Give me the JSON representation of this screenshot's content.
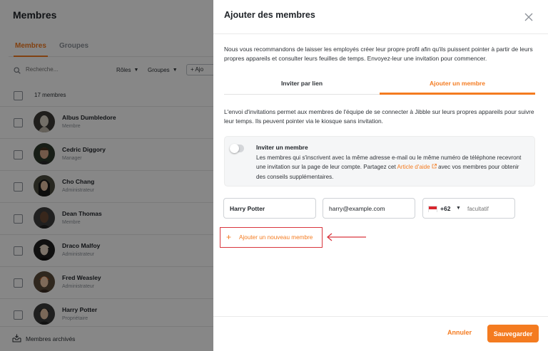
{
  "page": {
    "title": "Membres",
    "tabs": [
      {
        "label": "Membres",
        "active": true
      },
      {
        "label": "Groupes",
        "active": false
      }
    ],
    "search_placeholder": "Recherche...",
    "filters": {
      "roles": "Rôles",
      "groups": "Groupes"
    },
    "add_button": "Ajo",
    "members_count": "17 membres",
    "members": [
      {
        "name": "Albus Dumbledore",
        "role": "Membre"
      },
      {
        "name": "Cedric Diggory",
        "role": "Manager"
      },
      {
        "name": "Cho Chang",
        "role": "Administrateur"
      },
      {
        "name": "Dean Thomas",
        "role": "Membre"
      },
      {
        "name": "Draco Malfoy",
        "role": "Administrateur"
      },
      {
        "name": "Fred Weasley",
        "role": "Administrateur"
      },
      {
        "name": "Harry Potter",
        "role": "Propriétaire"
      }
    ],
    "archived_label": "Membres archivés"
  },
  "modal": {
    "title": "Ajouter des membres",
    "intro": "Nous vous recommandons de laisser les employés créer leur propre profil afin qu'ils puissent pointer à partir de leurs propres appareils et consulter leurs feuilles de temps. Envoyez-leur une invitation pour commencer.",
    "tabs": [
      {
        "label": "Inviter par lien",
        "active": false
      },
      {
        "label": "Ajouter un membre",
        "active": true
      }
    ],
    "description": "L'envoi d'invitations permet aux membres de l'équipe de se connecter à Jibble sur leurs propres appareils pour suivre leur temps. Ils peuvent pointer via le kiosque sans invitation.",
    "invite": {
      "title": "Inviter un membre",
      "text_before": "Les membres qui s'inscrivent avec la même adresse e-mail ou le même numéro de téléphone recevront une invitation sur la page de leur compte. Partagez cet ",
      "link": "Article d'aide",
      "text_after": " avec vos membres pour obtenir des conseils supplémentaires.",
      "enabled": false
    },
    "form": {
      "name_value": "Harry Potter",
      "email_value": "harry@example.com",
      "phone_code": "+62",
      "phone_placeholder": "facultatif"
    },
    "add_new_label": "Ajouter un nouveau membre",
    "cancel_label": "Annuler",
    "save_label": "Sauvegarder"
  },
  "colors": {
    "accent": "#f47b20",
    "highlight_border": "#d9363e"
  }
}
